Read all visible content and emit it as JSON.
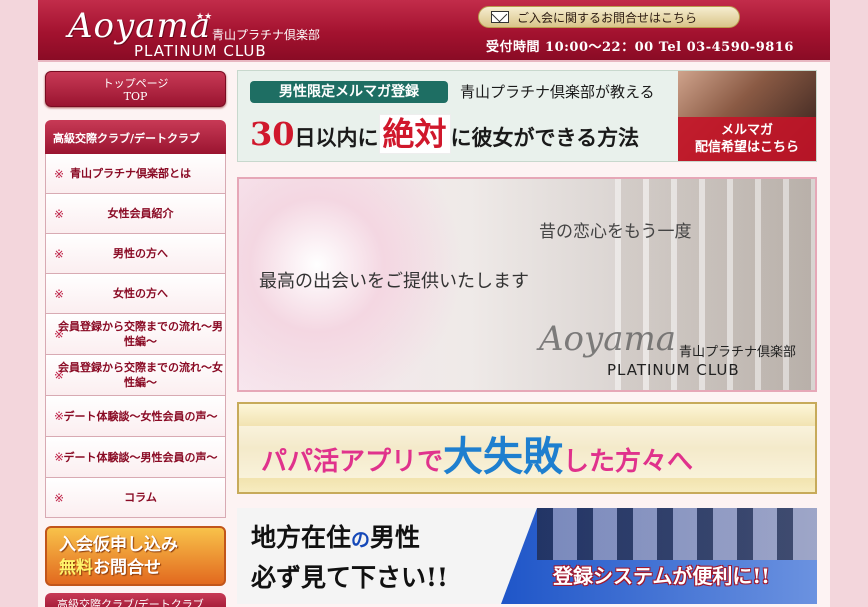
{
  "header": {
    "logo_script": "Aoyama",
    "logo_jp": "青山プラチナ倶楽部",
    "logo_en": "PLATINUM CLUB",
    "contact_label": "ご入会に関するお問合せはこちら",
    "hours_text": "受付時間 10:00～22：00  Tel 03-4590-9816"
  },
  "sidebar": {
    "top_label": "トップページ",
    "top_sub": "TOP",
    "menu_heading": "高級交際クラブ/デートクラブ",
    "items": [
      {
        "label": "青山プラチナ倶楽部とは"
      },
      {
        "label": "女性会員紹介"
      },
      {
        "label": "男性の方へ"
      },
      {
        "label": "女性の方へ"
      },
      {
        "label": "会員登録から交際までの流れ～男性編～"
      },
      {
        "label": "会員登録から交際までの流れ～女性編～"
      },
      {
        "label": "デート体験談～女性会員の声～"
      },
      {
        "label": "デート体験談～男性会員の声～"
      },
      {
        "label": "コラム"
      }
    ],
    "apply_line1": "入会仮申し込み",
    "apply_hl": "無料",
    "apply_line2_rest": "お問合せ",
    "bottom_partial": "高級交際クラブ/デートクラブ"
  },
  "main": {
    "mail_banner": {
      "tag": "男性限定メルマガ登録",
      "sub": "青山プラチナ倶楽部が教える",
      "num": "30",
      "pre": "日以内に",
      "emph": "絶対",
      "post": "に彼女ができる方法",
      "photo_label_1": "メルマガ",
      "photo_label_2": "配信希望はこちら"
    },
    "hero": {
      "top_text": "昔の恋心をもう一度",
      "main_text": "最高の出会いをご提供いたします",
      "logo_script": "Aoyama",
      "logo_jp": "青山プラチナ倶楽部",
      "logo_en": "PLATINUM CLUB"
    },
    "papa": {
      "pre": "パパ活アプリで",
      "big1": "大失敗",
      "post": "した方々へ"
    },
    "region": {
      "w1": "地方在住",
      "w2": "の",
      "w3": "男性",
      "line2": "必ず見て下さい!!",
      "right": "登録システムが便利に!!"
    }
  }
}
